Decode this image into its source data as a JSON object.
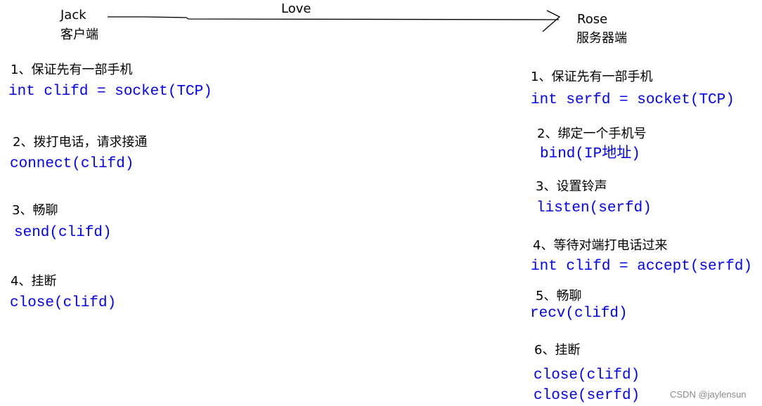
{
  "header": {
    "client_name": "Jack",
    "client_role": "客户端",
    "arrow_label": "Love",
    "server_name": "Rose",
    "server_role": "服务器端"
  },
  "client_steps": [
    {
      "label": "1、保证先有一部手机",
      "code": "int clifd = socket(TCP)"
    },
    {
      "label": "2、拨打电话，请求接通",
      "code": "connect(clifd)"
    },
    {
      "label": "3、畅聊",
      "code": "send(clifd)"
    },
    {
      "label": "4、挂断",
      "code": "close(clifd)"
    }
  ],
  "server_steps": [
    {
      "label": "1、保证先有一部手机",
      "code": "int serfd = socket(TCP)"
    },
    {
      "label": "2、绑定一个手机号",
      "code": "bind(IP地址)"
    },
    {
      "label": "3、设置铃声",
      "code": "listen(serfd)"
    },
    {
      "label": "4、等待对端打电话过来",
      "code": "int clifd = accept(serfd)"
    },
    {
      "label": "5、畅聊",
      "code": "recv(clifd)"
    },
    {
      "label": "6、挂断",
      "code": "close(clifd)",
      "code2": "close(serfd)"
    }
  ],
  "watermark": "CSDN @jaylensun",
  "colors": {
    "code": "#0000ff",
    "text": "#000000"
  }
}
